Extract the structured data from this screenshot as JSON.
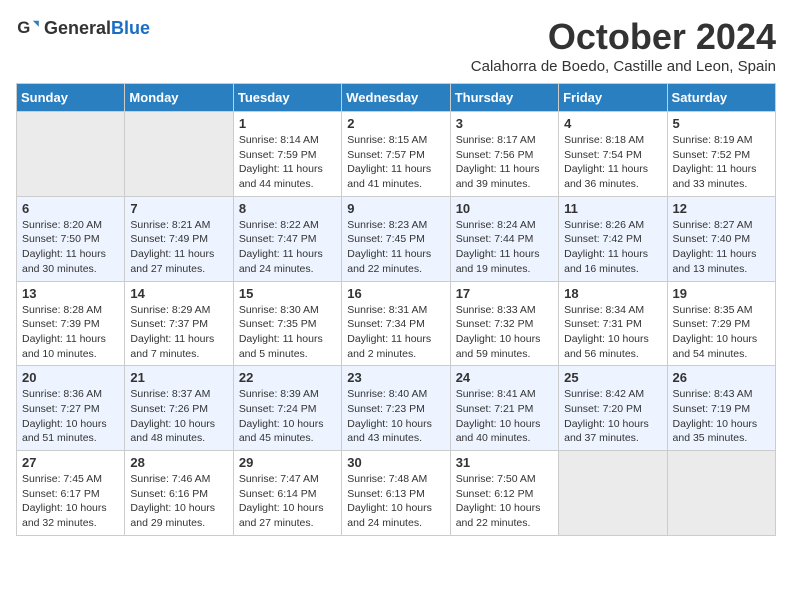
{
  "header": {
    "logo_general": "General",
    "logo_blue": "Blue",
    "month_title": "October 2024",
    "subtitle": "Calahorra de Boedo, Castille and Leon, Spain"
  },
  "weekdays": [
    "Sunday",
    "Monday",
    "Tuesday",
    "Wednesday",
    "Thursday",
    "Friday",
    "Saturday"
  ],
  "weeks": [
    [
      {
        "day": "",
        "sunrise": "",
        "sunset": "",
        "daylight": "",
        "empty": true
      },
      {
        "day": "",
        "sunrise": "",
        "sunset": "",
        "daylight": "",
        "empty": true
      },
      {
        "day": "1",
        "sunrise": "Sunrise: 8:14 AM",
        "sunset": "Sunset: 7:59 PM",
        "daylight": "Daylight: 11 hours and 44 minutes.",
        "empty": false
      },
      {
        "day": "2",
        "sunrise": "Sunrise: 8:15 AM",
        "sunset": "Sunset: 7:57 PM",
        "daylight": "Daylight: 11 hours and 41 minutes.",
        "empty": false
      },
      {
        "day": "3",
        "sunrise": "Sunrise: 8:17 AM",
        "sunset": "Sunset: 7:56 PM",
        "daylight": "Daylight: 11 hours and 39 minutes.",
        "empty": false
      },
      {
        "day": "4",
        "sunrise": "Sunrise: 8:18 AM",
        "sunset": "Sunset: 7:54 PM",
        "daylight": "Daylight: 11 hours and 36 minutes.",
        "empty": false
      },
      {
        "day": "5",
        "sunrise": "Sunrise: 8:19 AM",
        "sunset": "Sunset: 7:52 PM",
        "daylight": "Daylight: 11 hours and 33 minutes.",
        "empty": false
      }
    ],
    [
      {
        "day": "6",
        "sunrise": "Sunrise: 8:20 AM",
        "sunset": "Sunset: 7:50 PM",
        "daylight": "Daylight: 11 hours and 30 minutes.",
        "empty": false
      },
      {
        "day": "7",
        "sunrise": "Sunrise: 8:21 AM",
        "sunset": "Sunset: 7:49 PM",
        "daylight": "Daylight: 11 hours and 27 minutes.",
        "empty": false
      },
      {
        "day": "8",
        "sunrise": "Sunrise: 8:22 AM",
        "sunset": "Sunset: 7:47 PM",
        "daylight": "Daylight: 11 hours and 24 minutes.",
        "empty": false
      },
      {
        "day": "9",
        "sunrise": "Sunrise: 8:23 AM",
        "sunset": "Sunset: 7:45 PM",
        "daylight": "Daylight: 11 hours and 22 minutes.",
        "empty": false
      },
      {
        "day": "10",
        "sunrise": "Sunrise: 8:24 AM",
        "sunset": "Sunset: 7:44 PM",
        "daylight": "Daylight: 11 hours and 19 minutes.",
        "empty": false
      },
      {
        "day": "11",
        "sunrise": "Sunrise: 8:26 AM",
        "sunset": "Sunset: 7:42 PM",
        "daylight": "Daylight: 11 hours and 16 minutes.",
        "empty": false
      },
      {
        "day": "12",
        "sunrise": "Sunrise: 8:27 AM",
        "sunset": "Sunset: 7:40 PM",
        "daylight": "Daylight: 11 hours and 13 minutes.",
        "empty": false
      }
    ],
    [
      {
        "day": "13",
        "sunrise": "Sunrise: 8:28 AM",
        "sunset": "Sunset: 7:39 PM",
        "daylight": "Daylight: 11 hours and 10 minutes.",
        "empty": false
      },
      {
        "day": "14",
        "sunrise": "Sunrise: 8:29 AM",
        "sunset": "Sunset: 7:37 PM",
        "daylight": "Daylight: 11 hours and 7 minutes.",
        "empty": false
      },
      {
        "day": "15",
        "sunrise": "Sunrise: 8:30 AM",
        "sunset": "Sunset: 7:35 PM",
        "daylight": "Daylight: 11 hours and 5 minutes.",
        "empty": false
      },
      {
        "day": "16",
        "sunrise": "Sunrise: 8:31 AM",
        "sunset": "Sunset: 7:34 PM",
        "daylight": "Daylight: 11 hours and 2 minutes.",
        "empty": false
      },
      {
        "day": "17",
        "sunrise": "Sunrise: 8:33 AM",
        "sunset": "Sunset: 7:32 PM",
        "daylight": "Daylight: 10 hours and 59 minutes.",
        "empty": false
      },
      {
        "day": "18",
        "sunrise": "Sunrise: 8:34 AM",
        "sunset": "Sunset: 7:31 PM",
        "daylight": "Daylight: 10 hours and 56 minutes.",
        "empty": false
      },
      {
        "day": "19",
        "sunrise": "Sunrise: 8:35 AM",
        "sunset": "Sunset: 7:29 PM",
        "daylight": "Daylight: 10 hours and 54 minutes.",
        "empty": false
      }
    ],
    [
      {
        "day": "20",
        "sunrise": "Sunrise: 8:36 AM",
        "sunset": "Sunset: 7:27 PM",
        "daylight": "Daylight: 10 hours and 51 minutes.",
        "empty": false
      },
      {
        "day": "21",
        "sunrise": "Sunrise: 8:37 AM",
        "sunset": "Sunset: 7:26 PM",
        "daylight": "Daylight: 10 hours and 48 minutes.",
        "empty": false
      },
      {
        "day": "22",
        "sunrise": "Sunrise: 8:39 AM",
        "sunset": "Sunset: 7:24 PM",
        "daylight": "Daylight: 10 hours and 45 minutes.",
        "empty": false
      },
      {
        "day": "23",
        "sunrise": "Sunrise: 8:40 AM",
        "sunset": "Sunset: 7:23 PM",
        "daylight": "Daylight: 10 hours and 43 minutes.",
        "empty": false
      },
      {
        "day": "24",
        "sunrise": "Sunrise: 8:41 AM",
        "sunset": "Sunset: 7:21 PM",
        "daylight": "Daylight: 10 hours and 40 minutes.",
        "empty": false
      },
      {
        "day": "25",
        "sunrise": "Sunrise: 8:42 AM",
        "sunset": "Sunset: 7:20 PM",
        "daylight": "Daylight: 10 hours and 37 minutes.",
        "empty": false
      },
      {
        "day": "26",
        "sunrise": "Sunrise: 8:43 AM",
        "sunset": "Sunset: 7:19 PM",
        "daylight": "Daylight: 10 hours and 35 minutes.",
        "empty": false
      }
    ],
    [
      {
        "day": "27",
        "sunrise": "Sunrise: 7:45 AM",
        "sunset": "Sunset: 6:17 PM",
        "daylight": "Daylight: 10 hours and 32 minutes.",
        "empty": false
      },
      {
        "day": "28",
        "sunrise": "Sunrise: 7:46 AM",
        "sunset": "Sunset: 6:16 PM",
        "daylight": "Daylight: 10 hours and 29 minutes.",
        "empty": false
      },
      {
        "day": "29",
        "sunrise": "Sunrise: 7:47 AM",
        "sunset": "Sunset: 6:14 PM",
        "daylight": "Daylight: 10 hours and 27 minutes.",
        "empty": false
      },
      {
        "day": "30",
        "sunrise": "Sunrise: 7:48 AM",
        "sunset": "Sunset: 6:13 PM",
        "daylight": "Daylight: 10 hours and 24 minutes.",
        "empty": false
      },
      {
        "day": "31",
        "sunrise": "Sunrise: 7:50 AM",
        "sunset": "Sunset: 6:12 PM",
        "daylight": "Daylight: 10 hours and 22 minutes.",
        "empty": false
      },
      {
        "day": "",
        "sunrise": "",
        "sunset": "",
        "daylight": "",
        "empty": true
      },
      {
        "day": "",
        "sunrise": "",
        "sunset": "",
        "daylight": "",
        "empty": true
      }
    ]
  ]
}
